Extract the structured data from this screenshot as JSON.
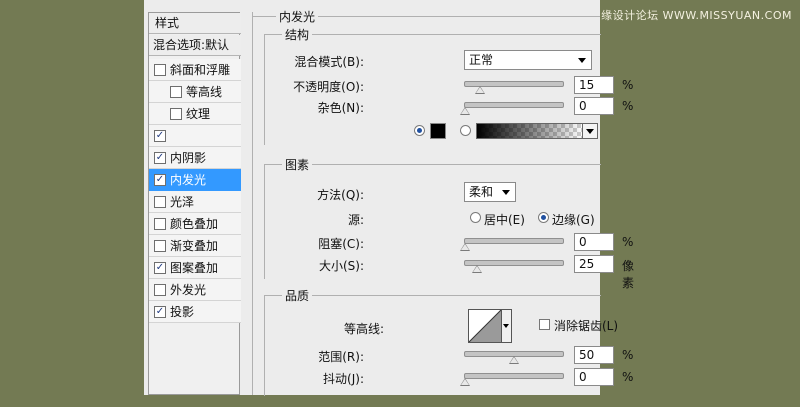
{
  "watermark": "思缘设计论坛 WWW.MISSYUAN.COM",
  "styles_panel": {
    "header": "样式",
    "blend_options": "混合选项:默认",
    "items": [
      {
        "label": "斜面和浮雕",
        "checked": false,
        "indent": false
      },
      {
        "label": "等高线",
        "checked": false,
        "indent": true
      },
      {
        "label": "纹理",
        "checked": false,
        "indent": true
      },
      {
        "label": "",
        "checked": true,
        "indent": false
      },
      {
        "label": "内阴影",
        "checked": true,
        "indent": false
      },
      {
        "label": "内发光",
        "checked": true,
        "indent": false,
        "selected": true
      },
      {
        "label": "光泽",
        "checked": false,
        "indent": false
      },
      {
        "label": "颜色叠加",
        "checked": false,
        "indent": false
      },
      {
        "label": "渐变叠加",
        "checked": false,
        "indent": false
      },
      {
        "label": "图案叠加",
        "checked": true,
        "indent": false
      },
      {
        "label": "外发光",
        "checked": false,
        "indent": false
      },
      {
        "label": "投影",
        "checked": true,
        "indent": false
      }
    ]
  },
  "inner_glow": {
    "title": "内发光",
    "structure": {
      "title": "结构",
      "blend_mode_label": "混合模式(B):",
      "blend_mode_value": "正常",
      "opacity_label": "不透明度(O):",
      "opacity_value": "15",
      "noise_label": "杂色(N):",
      "noise_value": "0",
      "percent": "%"
    },
    "elements": {
      "title": "图素",
      "method_label": "方法(Q):",
      "method_value": "柔和",
      "source_label": "源:",
      "source_center": "居中(E)",
      "source_edge": "边缘(G)",
      "choke_label": "阻塞(C):",
      "choke_value": "0",
      "size_label": "大小(S):",
      "size_value": "25",
      "size_unit": "像素",
      "percent": "%"
    },
    "quality": {
      "title": "品质",
      "contour_label": "等高线:",
      "antialias_label": "消除锯齿(L)",
      "range_label": "范围(R):",
      "range_value": "50",
      "jitter_label": "抖动(J):",
      "jitter_value": "0",
      "percent": "%"
    }
  }
}
